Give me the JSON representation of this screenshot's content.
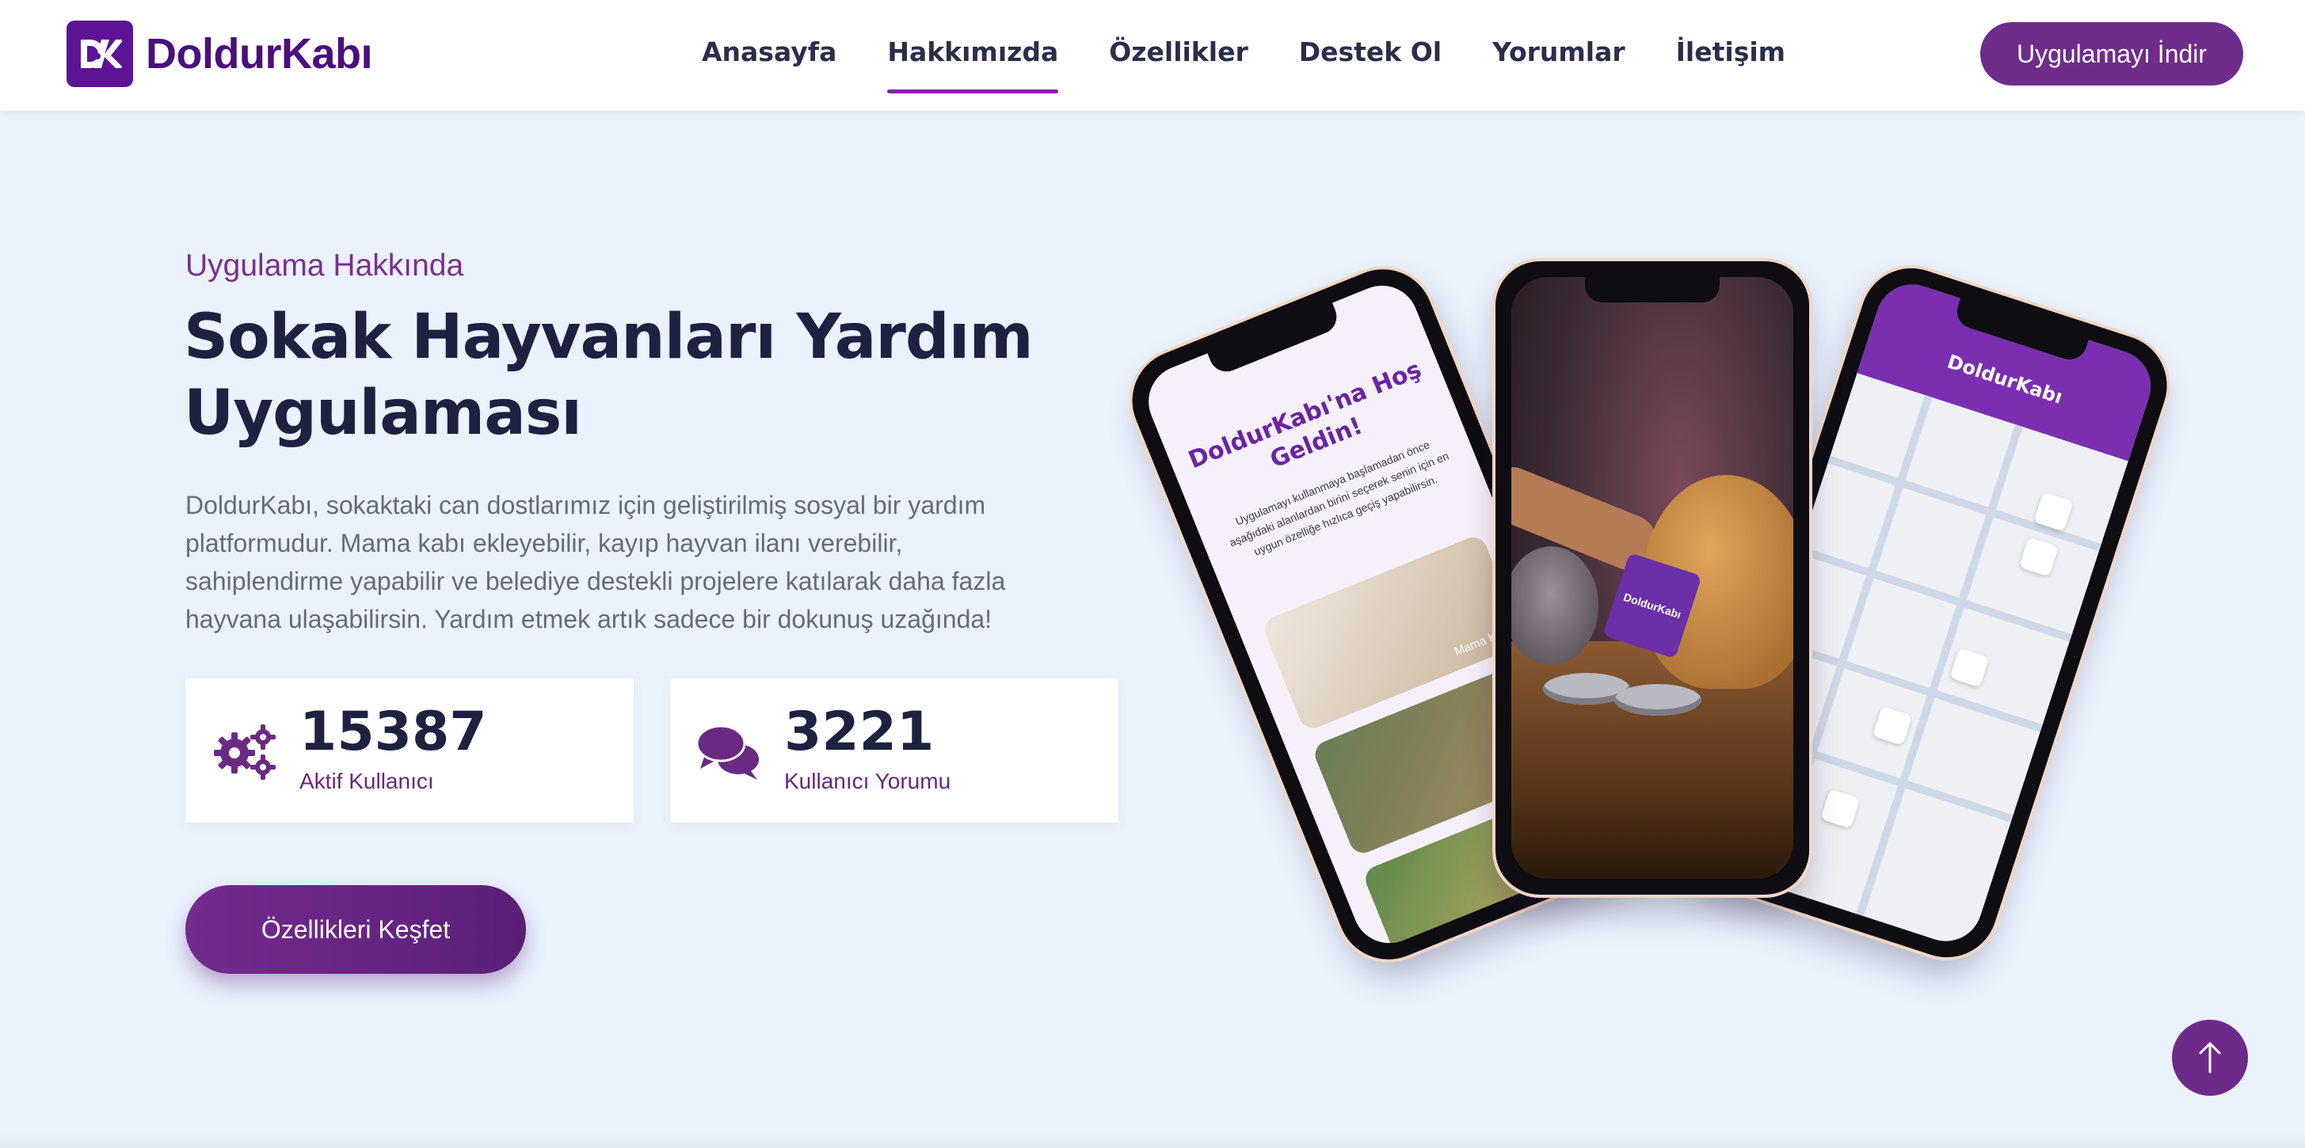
{
  "header": {
    "logo_text": "DoldurKabı",
    "logo_icon": "paw-logo-icon",
    "nav": [
      {
        "label": "Anasayfa"
      },
      {
        "label": "Hakkımızda",
        "active": true
      },
      {
        "label": "Özellikler"
      },
      {
        "label": "Destek Ol"
      },
      {
        "label": "Yorumlar"
      },
      {
        "label": "İletişim"
      }
    ],
    "download_label": "Uygulamayı İndir"
  },
  "hero": {
    "eyebrow": "Uygulama Hakkında",
    "title": "Sokak Hayvanları Yardım Uygulaması",
    "description": "DoldurKabı, sokaktaki can dostlarımız için geliştirilmiş sosyal bir yardım platformudur. Mama kabı ekleyebilir, kayıp hayvan ilanı verebilir, sahiplendirme yapabilir ve belediye destekli projelere katılarak daha fazla hayvana ulaşabilirsin. Yardım etmek artık sadece bir dokunuş uzağında!",
    "stats": [
      {
        "value": "15387",
        "label": "Aktif Kullanıcı",
        "icon": "gears-icon"
      },
      {
        "value": "3221",
        "label": "Kullanıcı Yorumu",
        "icon": "comments-icon"
      }
    ],
    "cta_label": "Özellikleri Keşfet"
  },
  "phones": {
    "welcome_title": "DoldurKabı'na Hoş Geldin!",
    "welcome_text": "Uygulamayı kullanmaya başlamadan önce aşağıdaki alanlardan birini seçerek senin için en uygun özelliğe hızlıca geçiş yapabilirsin.",
    "welcome_item_label": "Mama Kabı",
    "bag_label": "DoldurKabı",
    "map_title": "DoldurKabı"
  },
  "colors": {
    "brand": "#5b1494",
    "accent": "#6f2c8b",
    "background": "#eaf2fd",
    "heading": "#1e2240"
  },
  "back_to_top_icon": "arrow-up-icon"
}
